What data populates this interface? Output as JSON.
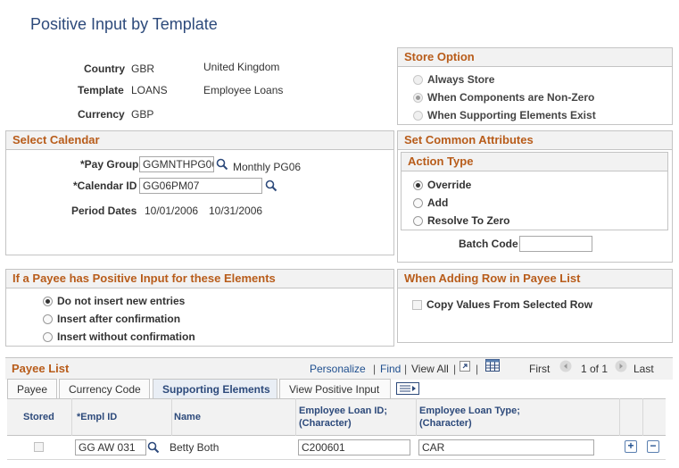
{
  "page_title": "Positive Input by Template",
  "header": {
    "country_label": "Country",
    "country_code": "GBR",
    "country_name": "United Kingdom",
    "template_label": "Template",
    "template_code": "LOANS",
    "template_name": "Employee Loans",
    "currency_label": "Currency",
    "currency_code": "GBP"
  },
  "store_option": {
    "title": "Store Option",
    "options": [
      "Always Store",
      "When Components are Non-Zero",
      "When Supporting Elements Exist"
    ],
    "selected_index": 1
  },
  "select_calendar": {
    "title": "Select Calendar",
    "pay_group_label": "*Pay Group",
    "pay_group_value": "GGMNTHPG06",
    "pay_group_desc": "Monthly PG06",
    "calendar_id_label": "*Calendar ID",
    "calendar_id_value": "GG06PM07",
    "period_dates_label": "Period Dates",
    "period_start": "10/01/2006",
    "period_end": "10/31/2006"
  },
  "common_attributes": {
    "title": "Set Common Attributes",
    "action_type_title": "Action Type",
    "action_options": [
      "Override",
      "Add",
      "Resolve To Zero"
    ],
    "selected_index": 0,
    "batch_code_label": "Batch Code",
    "batch_code_value": ""
  },
  "positive_input_elements": {
    "title": "If a Payee has Positive Input for these Elements",
    "options": [
      "Do not insert new entries",
      "Insert after confirmation",
      "Insert without confirmation"
    ],
    "selected_index": 0
  },
  "adding_row": {
    "title": "When Adding Row in Payee List",
    "copy_label": "Copy Values From Selected Row"
  },
  "payee_list": {
    "title": "Payee List",
    "personalize": "Personalize",
    "find": "Find",
    "view_all": "View All",
    "first": "First",
    "range": "1 of 1",
    "last": "Last",
    "tabs": [
      "Payee",
      "Currency Code",
      "Supporting Elements",
      "View Positive Input"
    ],
    "columns": {
      "stored": "Stored",
      "empl_id": "*Empl ID",
      "name": "Name",
      "loan_id_1": "Employee Loan ID;",
      "loan_id_2": "(Character)",
      "loan_type_1": "Employee Loan Type;",
      "loan_type_2": "(Character)"
    },
    "rows": [
      {
        "empl_id": "GG AW 031",
        "name": "Betty Both",
        "loan_id": "C200601",
        "loan_type": "CAR"
      }
    ]
  }
}
